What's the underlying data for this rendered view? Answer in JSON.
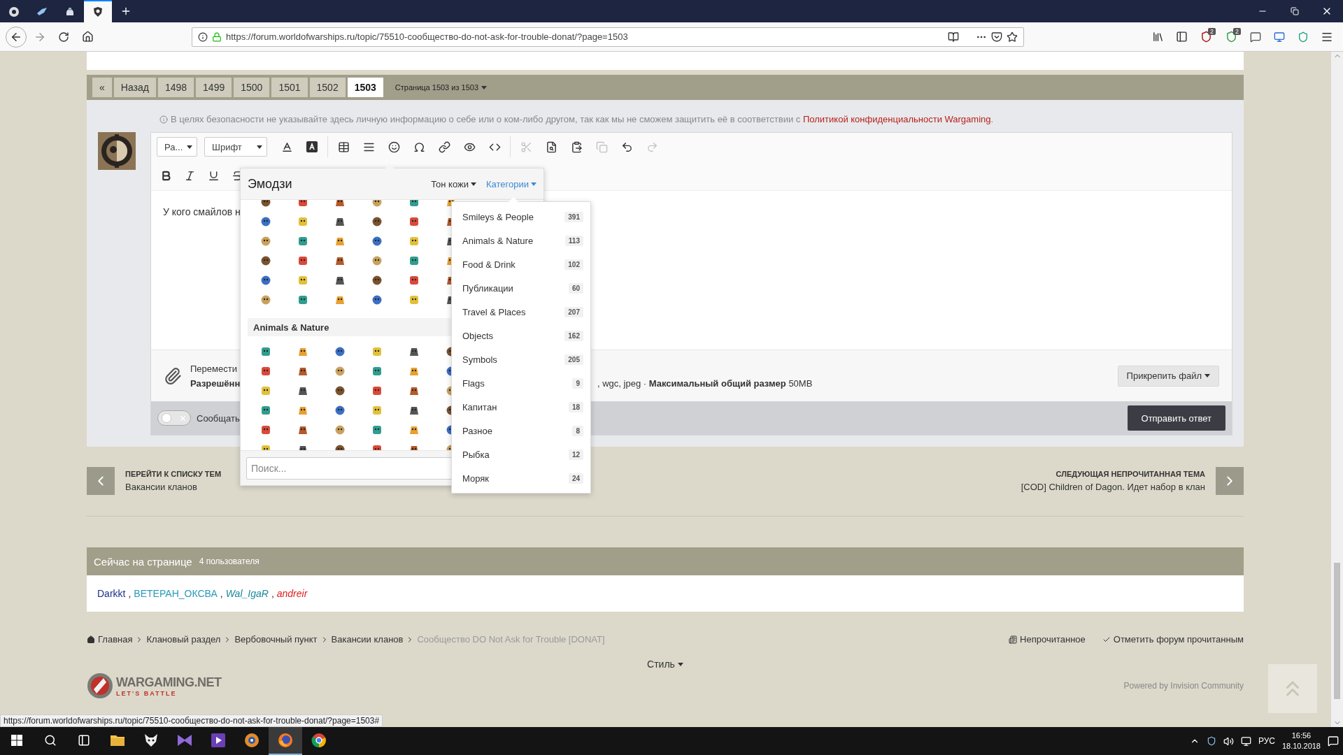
{
  "browser": {
    "tabs": [
      {
        "kind": "gear",
        "selected": false
      },
      {
        "kind": "bird",
        "selected": false
      },
      {
        "kind": "helmet",
        "selected": false
      },
      {
        "kind": "shield",
        "selected": true
      }
    ],
    "url": "https://forum.worldofwarships.ru/topic/75510-сообщество-do-not-ask-for-trouble-donat/?page=1503",
    "extension_badges": [
      "2",
      "2"
    ]
  },
  "pagination": {
    "first": "«",
    "back": "Назад",
    "pages": [
      {
        "label": "1498",
        "selected": false
      },
      {
        "label": "1499",
        "selected": false
      },
      {
        "label": "1500",
        "selected": false
      },
      {
        "label": "1501",
        "selected": false
      },
      {
        "label": "1502",
        "selected": false
      },
      {
        "label": "1503",
        "selected": true
      }
    ],
    "page_info": "Страница 1503 из 1503"
  },
  "notice": {
    "text": "В целях безопасности не указывайте здесь личную информацию о себе или о ком-либо другом, так как мы не сможем защитить её в соответствии с ",
    "link": "Политикой конфиденциальности Wargaming",
    "end": "."
  },
  "editor": {
    "format_dropdown": "Ра...",
    "font_dropdown": "Шрифт",
    "toolbar_groups": [
      {
        "items": [
          {
            "kind": "text-color",
            "disabled": false
          },
          {
            "kind": "bg-color",
            "disabled": false
          }
        ]
      },
      {
        "items": [
          {
            "kind": "table",
            "disabled": false
          },
          {
            "kind": "rule",
            "disabled": false
          },
          {
            "kind": "emoji",
            "disabled": false
          },
          {
            "kind": "symbol",
            "disabled": false
          },
          {
            "kind": "link",
            "disabled": false
          },
          {
            "kind": "preview",
            "disabled": false
          },
          {
            "kind": "source",
            "disabled": false
          }
        ]
      },
      {
        "items": [
          {
            "kind": "cut",
            "disabled": true
          },
          {
            "kind": "find",
            "disabled": false
          },
          {
            "kind": "paste",
            "disabled": false
          },
          {
            "kind": "copy",
            "disabled": true
          },
          {
            "kind": "undo",
            "disabled": false
          },
          {
            "kind": "redo",
            "disabled": true
          }
        ]
      }
    ],
    "format_buttons": [
      {
        "kind": "bold"
      },
      {
        "kind": "italic"
      },
      {
        "kind": "underline"
      },
      {
        "kind": "strike"
      }
    ],
    "body_text": "У кого смайлов н",
    "attach_line1": "Перемести",
    "attach_line2": "Разрешённ",
    "attach_limits": ", wgc, jpeg · **Максимальный общий размер** 50MB",
    "attach_button": "Прикрепить файл",
    "notify_toggle": {
      "on": false,
      "label": "Сообщать"
    },
    "submit": "Отправить ответ"
  },
  "emoji_picker": {
    "title": "Эмодзи",
    "skin_tone": "Тон кожи",
    "categories_button": "Категории",
    "section_title": "Animals & Nature",
    "search_placeholder": "Поиск...",
    "categories": [
      {
        "label": "Smileys & People",
        "count": "391"
      },
      {
        "label": "Animals & Nature",
        "count": "113"
      },
      {
        "label": "Food & Drink",
        "count": "102"
      },
      {
        "label": "Публикации",
        "count": "60"
      },
      {
        "label": "Travel & Places",
        "count": "207"
      },
      {
        "label": "Objects",
        "count": "162"
      },
      {
        "label": "Symbols",
        "count": "205"
      },
      {
        "label": "Flags",
        "count": "9"
      },
      {
        "label": "Капитан",
        "count": "18"
      },
      {
        "label": "Разное",
        "count": "8"
      },
      {
        "label": "Рыбка",
        "count": "12"
      },
      {
        "label": "Моряк",
        "count": "24"
      }
    ]
  },
  "thread_nav": {
    "prev_label": "ПЕРЕЙТИ К СПИСКУ ТЕМ",
    "prev_title": "Вакансии кланов",
    "next_label": "СЛЕДУЮЩАЯ НЕПРОЧИТАННАЯ ТЕМА",
    "next_title": "[COD] Children of Dagon. Идет набор в клан"
  },
  "online": {
    "title": "Сейчас на странице",
    "count": "4 пользователя",
    "users": [
      {
        "name": "Darkkt",
        "color": "#1a2f8a",
        "italic": false,
        "separator": ","
      },
      {
        "name": "ВЕТЕРАН_ОКСВА",
        "color": "#2a9ab8",
        "italic": false,
        "separator": ","
      },
      {
        "name": "Wal_IgaR",
        "color": "#1a8a9a",
        "italic": true,
        "separator": ","
      },
      {
        "name": "andreir",
        "color": "#e01b1b",
        "italic": true
      }
    ]
  },
  "breadcrumb": [
    {
      "label": "Главная",
      "current": false
    },
    {
      "label": "Клановый раздел",
      "current": false
    },
    {
      "label": "Вербовочный пункт",
      "current": false
    },
    {
      "label": "Вакансии кланов",
      "current": false
    },
    {
      "label": "Сообщество DO Not Ask for Trouble [DONAT]",
      "current": true
    }
  ],
  "footer_links": [
    {
      "kind": "unread",
      "label": "Непрочитанное"
    },
    {
      "kind": "mark-read",
      "label": "Отметить форум прочитанным"
    }
  ],
  "style_menu": "Стиль",
  "logo": {
    "name": "WARGAMING.NET",
    "tagline": "LET'S BATTLE"
  },
  "powered_by": "Powered by Invision Community",
  "status_url": "https://forum.worldofwarships.ru/topic/75510-сообщество-do-not-ask-for-trouble-donat/?page=1503#",
  "taskbar": {
    "apps": [
      {
        "kind": "folder",
        "selected": false
      },
      {
        "kind": "mask",
        "selected": false
      },
      {
        "kind": "bowtie",
        "selected": false
      },
      {
        "kind": "play",
        "selected": false
      },
      {
        "kind": "sun",
        "selected": false
      },
      {
        "kind": "flame",
        "selected": true
      },
      {
        "kind": "wheel",
        "selected": false
      }
    ],
    "language": "РУС",
    "time": "16:56",
    "date": "18.10.2018"
  }
}
